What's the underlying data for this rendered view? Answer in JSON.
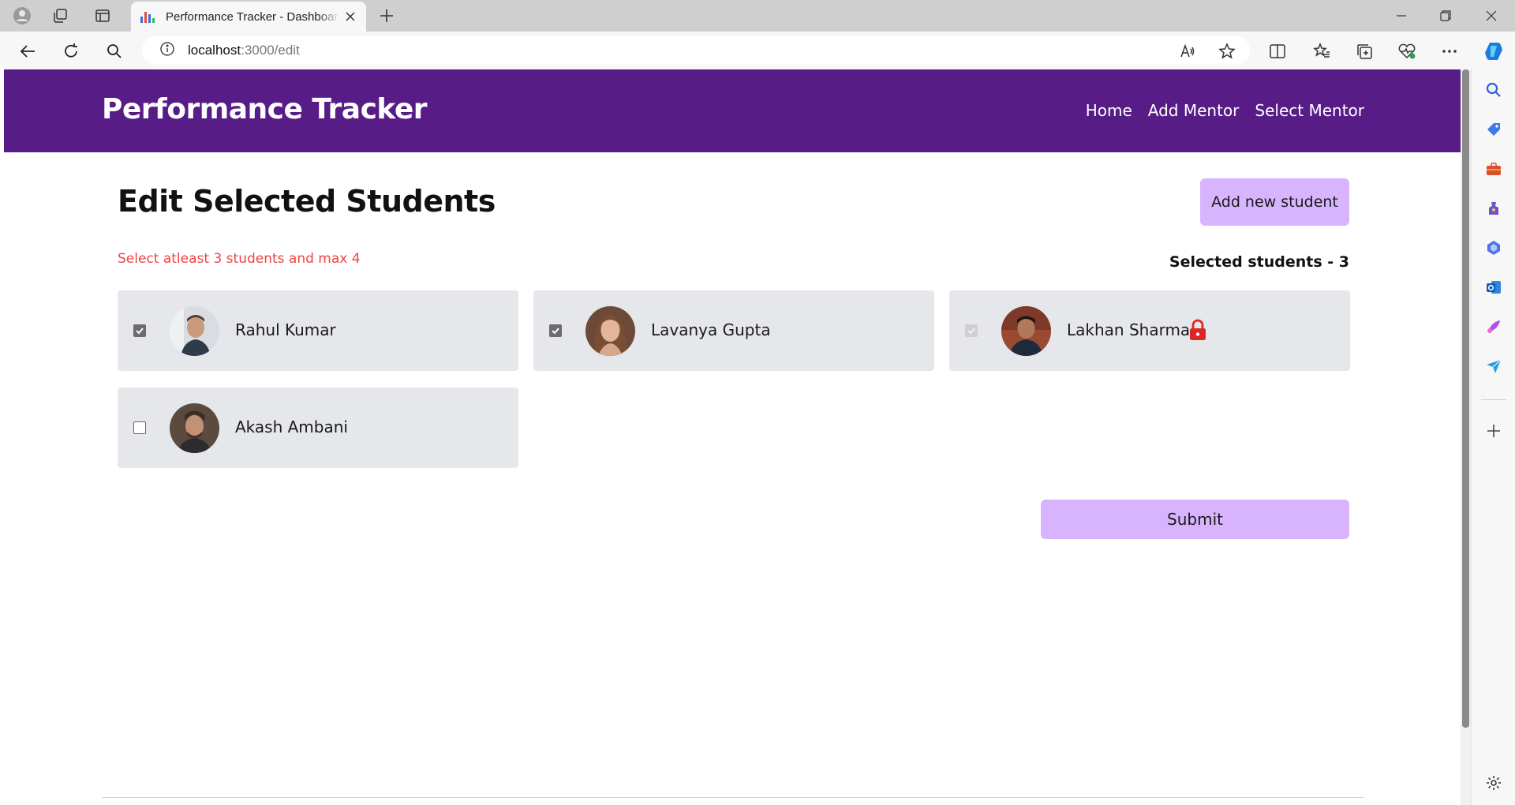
{
  "browser": {
    "tab_title": "Performance Tracker - Dashboard",
    "url_host": "localhost",
    "url_path": ":3000/edit"
  },
  "navbar": {
    "brand": "Performance Tracker",
    "links": [
      "Home",
      "Add Mentor",
      "Select Mentor"
    ]
  },
  "main": {
    "heading": "Edit Selected Students",
    "add_button": "Add new student",
    "warning": "Select atleast 3 students and max 4",
    "selected_count": "Selected students - 3",
    "submit_label": "Submit"
  },
  "students": [
    {
      "name": "Rahul Kumar",
      "checked": true,
      "locked": false
    },
    {
      "name": "Lavanya Gupta",
      "checked": true,
      "locked": false
    },
    {
      "name": "Lakhan Sharma",
      "checked": true,
      "locked": true
    },
    {
      "name": "Akash Ambani",
      "checked": false,
      "locked": false
    }
  ],
  "colors": {
    "navbar": "#581c87",
    "button": "#d8b4fe",
    "card": "#e5e7eb",
    "warning": "#ef4444",
    "lock": "#dc2626"
  }
}
